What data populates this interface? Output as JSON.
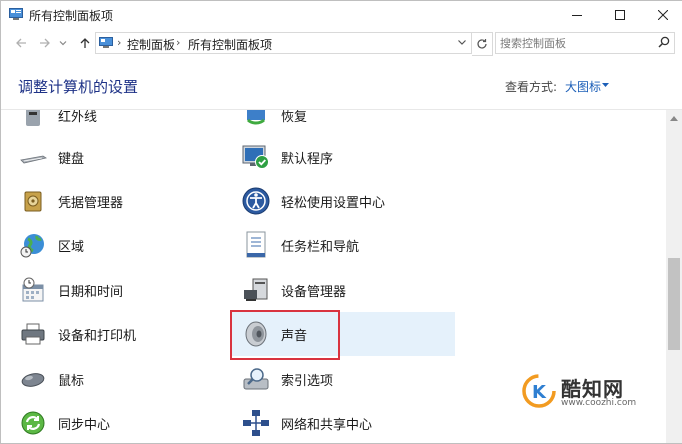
{
  "window": {
    "title": "所有控制面板项"
  },
  "address_bar": {
    "crumbs": [
      "控制面板",
      "所有控制面板项"
    ],
    "search_placeholder": "搜索控制面板"
  },
  "header": {
    "title": "调整计算机的设置",
    "view_by_label": "查看方式:",
    "view_by_value": "大图标"
  },
  "items_left": [
    {
      "label": "红外线",
      "icon": "infrared-icon"
    },
    {
      "label": "键盘",
      "icon": "keyboard-icon"
    },
    {
      "label": "凭据管理器",
      "icon": "credential-vault-icon"
    },
    {
      "label": "区域",
      "icon": "globe-clock-icon"
    },
    {
      "label": "日期和时间",
      "icon": "calendar-clock-icon"
    },
    {
      "label": "设备和打印机",
      "icon": "printer-icon"
    },
    {
      "label": "鼠标",
      "icon": "mouse-icon"
    },
    {
      "label": "同步中心",
      "icon": "sync-icon"
    }
  ],
  "items_right": [
    {
      "label": "恢复",
      "icon": "recovery-icon"
    },
    {
      "label": "默认程序",
      "icon": "default-programs-icon"
    },
    {
      "label": "轻松使用设置中心",
      "icon": "ease-of-access-icon"
    },
    {
      "label": "任务栏和导航",
      "icon": "taskbar-icon"
    },
    {
      "label": "设备管理器",
      "icon": "device-manager-icon"
    },
    {
      "label": "声音",
      "icon": "speaker-icon"
    },
    {
      "label": "索引选项",
      "icon": "indexing-icon"
    },
    {
      "label": "网络和共享中心",
      "icon": "network-icon"
    }
  ],
  "watermark": {
    "name": "酷知网",
    "url": "www.coozhi.com"
  },
  "colors": {
    "accent": "#1e3287",
    "link": "#1c5fb8",
    "highlight": "#d9333f",
    "selection": "#e5f1fb"
  }
}
